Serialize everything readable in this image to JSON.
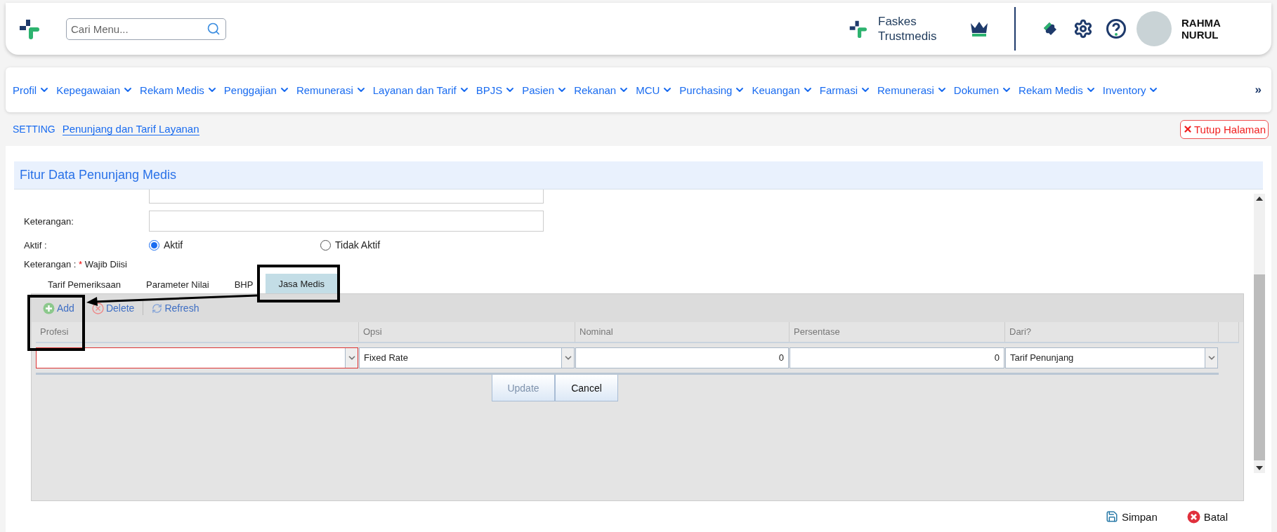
{
  "header": {
    "search": {
      "placeholder": "Cari Menu..."
    },
    "facility": "Faskes Trustmedis",
    "user_name": "RAHMA NURUL"
  },
  "nav": {
    "items": [
      "Profil",
      "Kepegawaian",
      "Rekam Medis",
      "Penggajian",
      "Remunerasi",
      "Layanan dan Tarif",
      "BPJS",
      "Pasien",
      "Rekanan",
      "MCU",
      "Purchasing",
      "Keuangan",
      "Farmasi",
      "Remunerasi",
      "Dokumen",
      "Rekam Medis",
      "Inventory"
    ],
    "more": "»"
  },
  "breadcrumb": {
    "section": "SETTING",
    "page": "Penunjang dan Tarif Layanan"
  },
  "close_button": "Tutup Halaman",
  "panel": {
    "title": "Fitur Data Penunjang Medis",
    "keterangan_label": "Keterangan:",
    "aktif": {
      "label": "Aktif :",
      "options": [
        {
          "label": "Aktif",
          "selected": true
        },
        {
          "label": "Tidak Aktif",
          "selected": false
        }
      ]
    },
    "required_note": {
      "prefix": "Keterangan :",
      "mark": "*",
      "text": "Wajib Diisi"
    },
    "tabs": [
      {
        "label": "Tarif Pemeriksaan",
        "selected": false
      },
      {
        "label": "Parameter Nilai",
        "selected": false
      },
      {
        "label": "BHP",
        "selected": false
      },
      {
        "label": "Jasa Medis",
        "selected": true
      }
    ],
    "toolbar": [
      {
        "kind": "add",
        "label": "Add"
      },
      {
        "kind": "delete",
        "label": "Delete"
      },
      {
        "kind": "refresh",
        "label": "Refresh"
      }
    ],
    "grid": {
      "columns": [
        "Profesi",
        "Opsi",
        "Nominal",
        "Persentase",
        "Dari?"
      ],
      "editor": [
        {
          "kind": "combo",
          "invalid": true
        },
        {
          "kind": "combo",
          "value": "Fixed Rate",
          "invalid": false
        },
        {
          "kind": "number",
          "value": "0",
          "invalid": false
        },
        {
          "kind": "number",
          "value": "0",
          "invalid": false
        },
        {
          "kind": "combo",
          "value": "Tarif Penunjang",
          "invalid": false
        }
      ],
      "actions": [
        {
          "label": "Update",
          "disabled": true
        },
        {
          "label": "Cancel",
          "disabled": false
        }
      ]
    }
  },
  "footer_buttons": [
    {
      "kind": "save",
      "label": "Simpan"
    },
    {
      "kind": "cancel",
      "label": "Batal"
    }
  ]
}
